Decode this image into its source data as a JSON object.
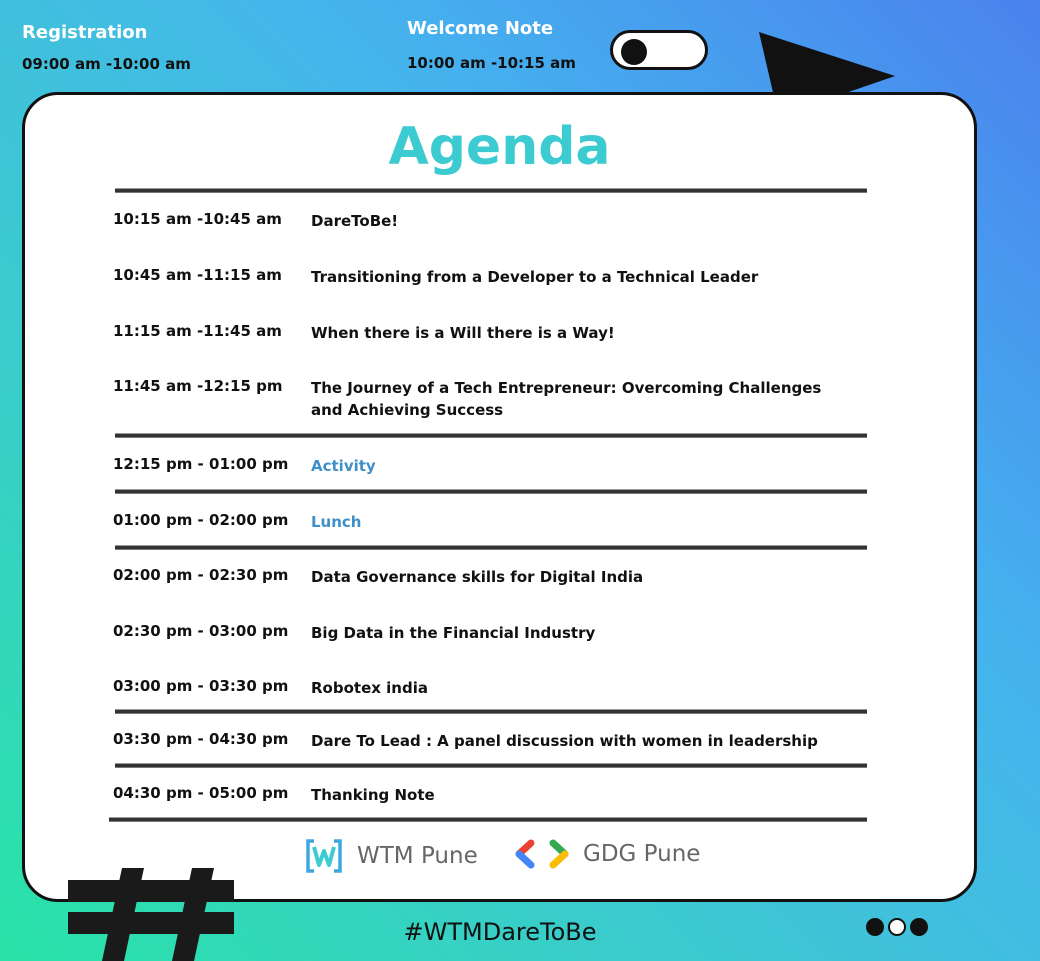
{
  "top": {
    "registration": {
      "title": "Registration",
      "time": "09:00 am -10:00 am"
    },
    "welcome": {
      "title": "Welcome Note",
      "time": "10:00 am -10:15 am"
    }
  },
  "agenda_title": "Agenda",
  "rows": [
    {
      "time": "10:15 am -10:45 am",
      "title": "DareToBe!"
    },
    {
      "time": "10:45 am -11:15 am",
      "title": "Transitioning from a Developer to a Technical Leader"
    },
    {
      "time": "11:15 am -11:45 am",
      "title": "When there is a Will there is a Way!"
    },
    {
      "time": "11:45 am -12:15 pm",
      "title": "The Journey of a Tech Entrepreneur: Overcoming Challenges and Achieving Success"
    },
    {
      "time": "12:15 pm - 01:00 pm",
      "title": "Activity"
    },
    {
      "time": "01:00 pm - 02:00 pm",
      "title": "Lunch"
    },
    {
      "time": "02:00 pm - 02:30 pm",
      "title": "Data Governance skills for Digital India"
    },
    {
      "time": "02:30 pm - 03:00 pm",
      "title": "Big Data in the Financial Industry"
    },
    {
      "time": "03:00 pm - 03:30 pm",
      "title": "Robotex india"
    },
    {
      "time": "03:30 pm - 04:30 pm",
      "title": "Dare To Lead : A panel discussion with women in leadership"
    },
    {
      "time": "04:30 pm - 05:00 pm",
      "title": "Thanking Note"
    }
  ],
  "sponsors": {
    "wtm": "WTM Pune",
    "gdg": "GDG Pune"
  },
  "hashtag": "#WTMDareToBe",
  "colors": {
    "accent": "#3ccbd0",
    "highlight": "#3f8fc8"
  }
}
